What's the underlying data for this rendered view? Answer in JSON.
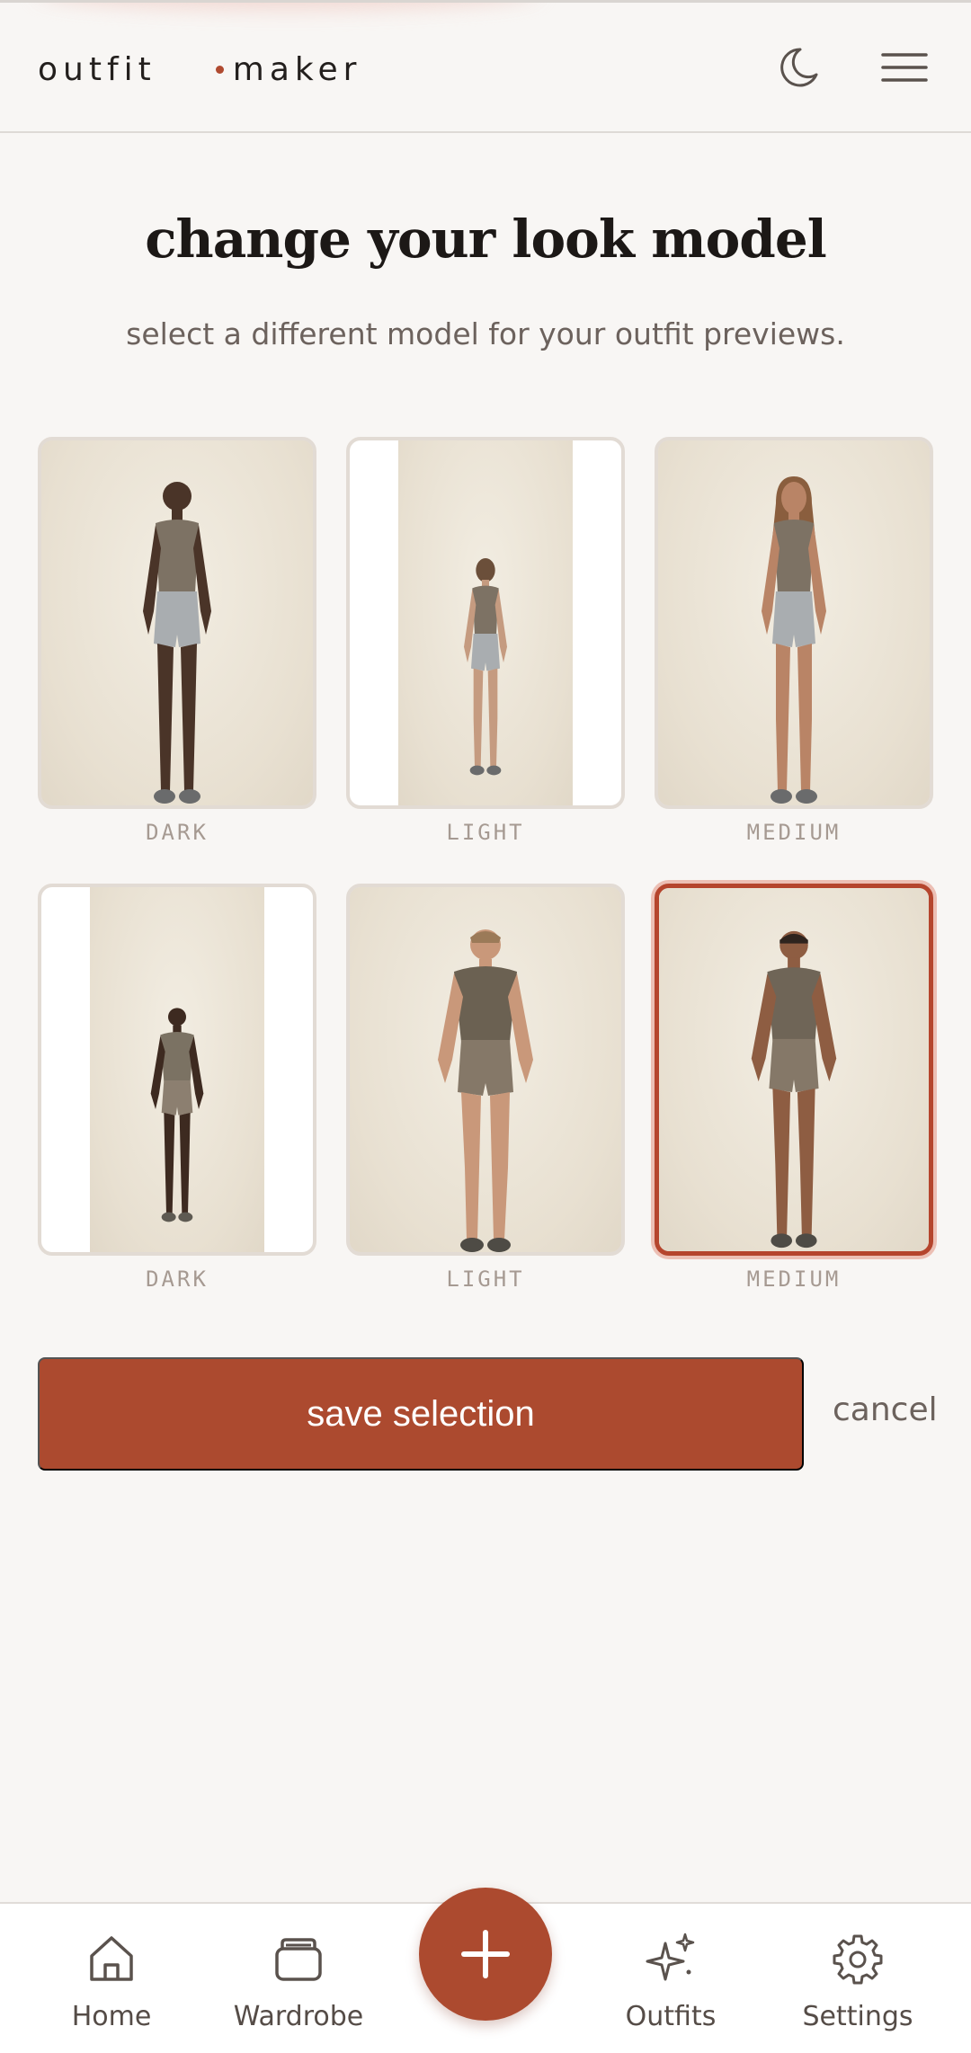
{
  "app": {
    "logo_part1": "outfit",
    "logo_part2": "maker"
  },
  "header_icons": [
    "moon-icon",
    "menu-icon"
  ],
  "page": {
    "title": "change your look model",
    "subtitle": "select a different model for your outfit previews."
  },
  "models": [
    {
      "label": "DARK",
      "selected": false
    },
    {
      "label": "LIGHT",
      "selected": false
    },
    {
      "label": "MEDIUM",
      "selected": false
    },
    {
      "label": "DARK",
      "selected": false
    },
    {
      "label": "LIGHT",
      "selected": false
    },
    {
      "label": "MEDIUM",
      "selected": true
    }
  ],
  "actions": {
    "save_label": "save selection",
    "cancel_label": "cancel"
  },
  "nav": {
    "items": [
      {
        "label": "Home",
        "icon": "home-icon"
      },
      {
        "label": "Wardrobe",
        "icon": "wardrobe-icon"
      },
      {
        "label": "Outfits",
        "icon": "sparkles-icon"
      },
      {
        "label": "Settings",
        "icon": "gear-icon"
      }
    ],
    "fab_icon": "plus-icon"
  },
  "colors": {
    "accent": "#ac4a2f",
    "background": "#f8f6f4",
    "selected_ring": "#ecbfb4"
  }
}
